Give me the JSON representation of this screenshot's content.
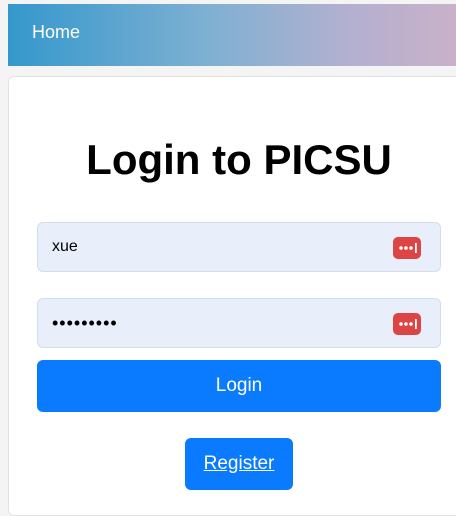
{
  "nav": {
    "home_label": "Home"
  },
  "login_form": {
    "title": "Login to PICSU",
    "username": {
      "value": "xue",
      "placeholder": ""
    },
    "password": {
      "value": "abcdefghi",
      "placeholder": ""
    },
    "password_manager_icon": "password-manager-icon",
    "login_label": "Login",
    "register_label": "Register"
  },
  "colors": {
    "primary_button": "#0a7bff",
    "input_background": "#e8effa",
    "password_manager_icon": "#dd4444"
  }
}
